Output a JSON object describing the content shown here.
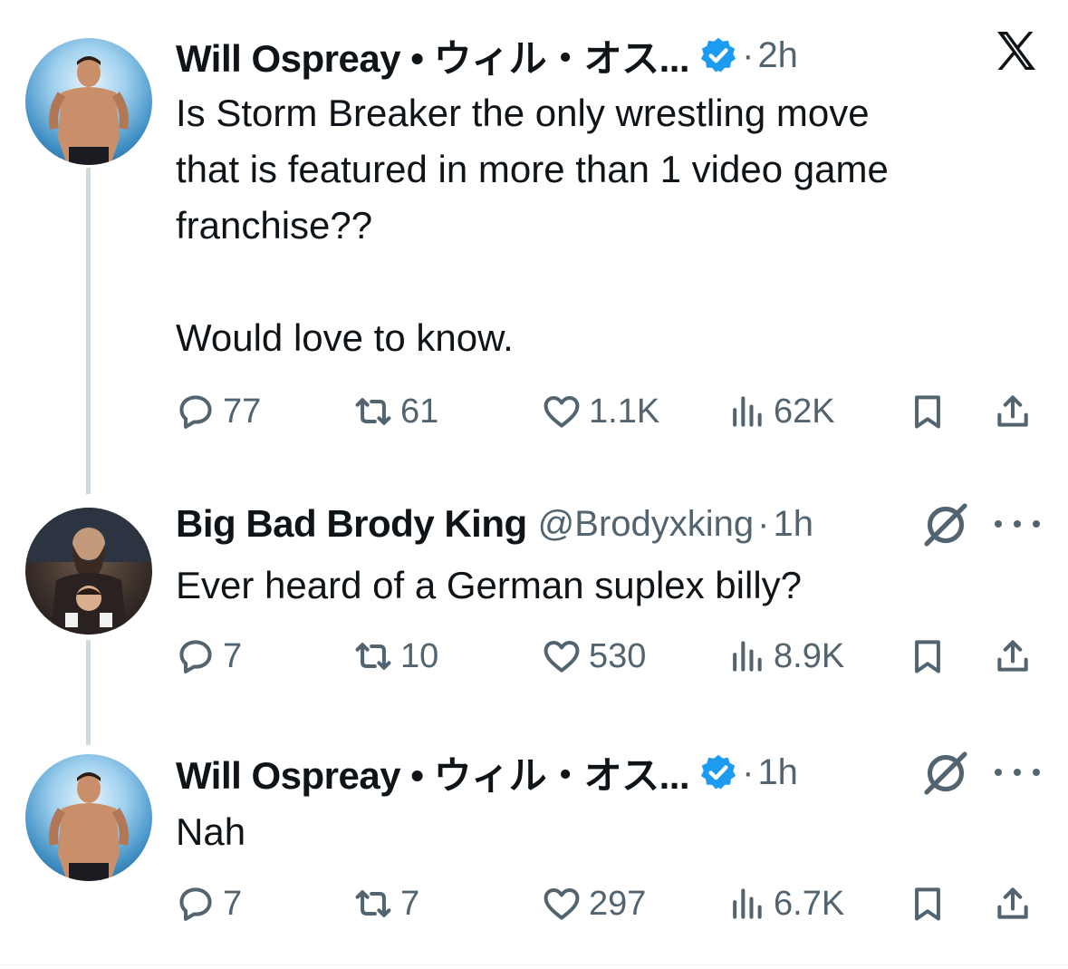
{
  "tweets": [
    {
      "display_name": "Will Ospreay • ウィル・オス...",
      "handle": "",
      "verified": true,
      "time": "2h",
      "text": "Is Storm Breaker the only wrestling move\nthat is featured in more than 1 video game\nfranchise??\n\nWould love to know.",
      "replies": "77",
      "reposts": "61",
      "likes": "1.1K",
      "views": "62K"
    },
    {
      "display_name": "Big Bad Brody King",
      "handle": "@Brodyxking",
      "verified": false,
      "time": "1h",
      "text": "Ever heard of a German suplex billy?",
      "replies": "7",
      "reposts": "10",
      "likes": "530",
      "views": "8.9K"
    },
    {
      "display_name": "Will Ospreay • ウィル・オス...",
      "handle": "",
      "verified": true,
      "time": "1h",
      "text": "Nah",
      "replies": "7",
      "reposts": "7",
      "likes": "297",
      "views": "6.7K"
    }
  ],
  "separator": "·",
  "colors": {
    "verified": "#1d9bf0",
    "muted": "#536471",
    "text": "#0f1419",
    "thread_line": "#cfd9de"
  }
}
